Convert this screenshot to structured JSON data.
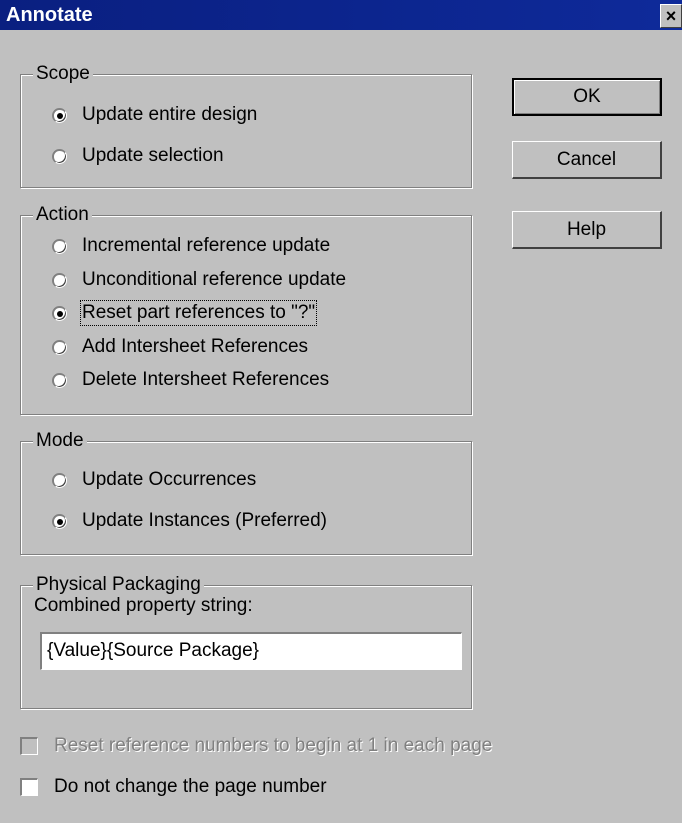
{
  "window": {
    "title": "Annotate",
    "close_glyph": "×"
  },
  "scope": {
    "legend": "Scope",
    "options": [
      {
        "label": "Update entire design",
        "checked": true
      },
      {
        "label": "Update selection",
        "checked": false
      }
    ]
  },
  "action": {
    "legend": "Action",
    "options": [
      {
        "label": "Incremental reference update",
        "checked": false
      },
      {
        "label": "Unconditional reference update",
        "checked": false
      },
      {
        "label": "Reset part references to \"?\"",
        "checked": true
      },
      {
        "label": "Add Intersheet References",
        "checked": false
      },
      {
        "label": "Delete Intersheet References",
        "checked": false
      }
    ]
  },
  "mode": {
    "legend": "Mode",
    "options": [
      {
        "label": "Update Occurrences",
        "checked": false
      },
      {
        "label": "Update Instances (Preferred)",
        "checked": true
      }
    ]
  },
  "packaging": {
    "legend": "Physical Packaging",
    "field_label": "Combined property string:",
    "field_value": "{Value}{Source Package}"
  },
  "checkboxes": {
    "reset_numbers": {
      "label": "Reset reference numbers to begin at 1 in each page",
      "checked": false,
      "enabled": false
    },
    "no_page_change": {
      "label": "Do not change the page number",
      "checked": false,
      "enabled": true
    }
  },
  "buttons": {
    "ok": "OK",
    "cancel": "Cancel",
    "help": "Help"
  }
}
